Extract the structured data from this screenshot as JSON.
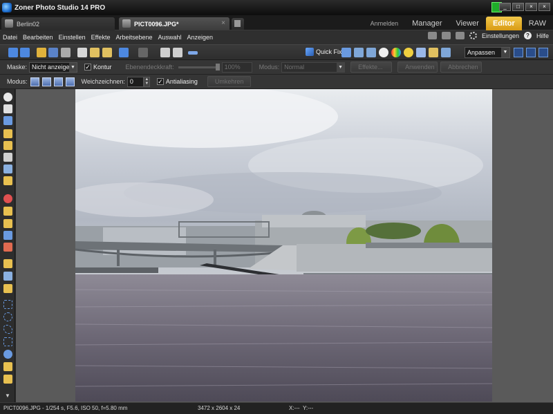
{
  "app": {
    "title": "Zoner Photo Studio 14 PRO",
    "window_controls": [
      "_",
      "□",
      "×",
      "×"
    ]
  },
  "tabs": [
    {
      "label": "Berlin02",
      "active": false
    },
    {
      "label": "PICT0096.JPG*",
      "active": true,
      "close": "×"
    }
  ],
  "modes": {
    "login": "Anmelden",
    "manager": "Manager",
    "viewer": "Viewer",
    "editor": "Editor",
    "raw": "RAW",
    "active": "Editor",
    "active_color": "#E8AE2C"
  },
  "menu": {
    "items": [
      "Datei",
      "Bearbeiten",
      "Einstellen",
      "Effekte",
      "Arbeitsebene",
      "Auswahl",
      "Anzeigen"
    ],
    "settings": "Einstellungen",
    "help": "Hilfe"
  },
  "toolbar": {
    "quick_fix": "Quick Fix",
    "zoom_value": "Anpassen"
  },
  "options": {
    "mask_label": "Maske:",
    "mask_value": "Nicht anzeigen",
    "contour": "Kontur",
    "layer_opacity_label": "Ebenendeckkraft:",
    "layer_opacity_value": "100%",
    "mode_label": "Modus:",
    "mode_value": "Normal",
    "effects": "Effekte...",
    "apply": "Anwenden",
    "cancel": "Abbrechen",
    "mode2_label": "Modus:",
    "feather_label": "Weichzeichnen:",
    "feather_value": "0",
    "antialiasing": "Antialiasing",
    "invert": "Umkehren"
  },
  "status": {
    "exif": "PICT0096.JPG - 1/254 s, F5.6, ISO 50, f=5.80 mm",
    "dimensions": "3472 x 2604 x 24",
    "x": "X:---",
    "y": "Y:---"
  },
  "colors": {
    "accent": "#E8AE2C",
    "indicator": "#1FAE2A",
    "canvas_bg": "#5A5A5A",
    "chrome": "#2F2F2F"
  }
}
